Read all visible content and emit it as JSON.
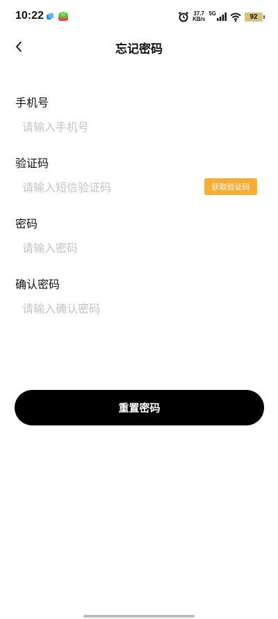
{
  "status_bar": {
    "time": "10:22",
    "speed_value": "37.7",
    "speed_unit": "KB/s",
    "network": "5G",
    "battery": "92",
    "icons": [
      "app-notification-icon",
      "game-notification-icon",
      "alarm-icon",
      "signal-icon",
      "wifi-icon",
      "battery-icon"
    ]
  },
  "header": {
    "back_icon": "chevron-left-icon",
    "title": "忘记密码"
  },
  "form": {
    "phone": {
      "label": "手机号",
      "placeholder": "请输入手机号",
      "value": ""
    },
    "sms_code": {
      "label": "验证码",
      "placeholder": "请输入短信验证码",
      "value": "",
      "button_label": "获取验证码"
    },
    "password": {
      "label": "密码",
      "placeholder": "请输入密码",
      "value": ""
    },
    "confirm_password": {
      "label": "确认密码",
      "placeholder": "请输入确认密码",
      "value": ""
    }
  },
  "submit_label": "重置密码",
  "colors": {
    "accent": "#f5ad35",
    "primary_button": "#000000",
    "placeholder": "#c4c4c8",
    "background": "#ffffff"
  }
}
